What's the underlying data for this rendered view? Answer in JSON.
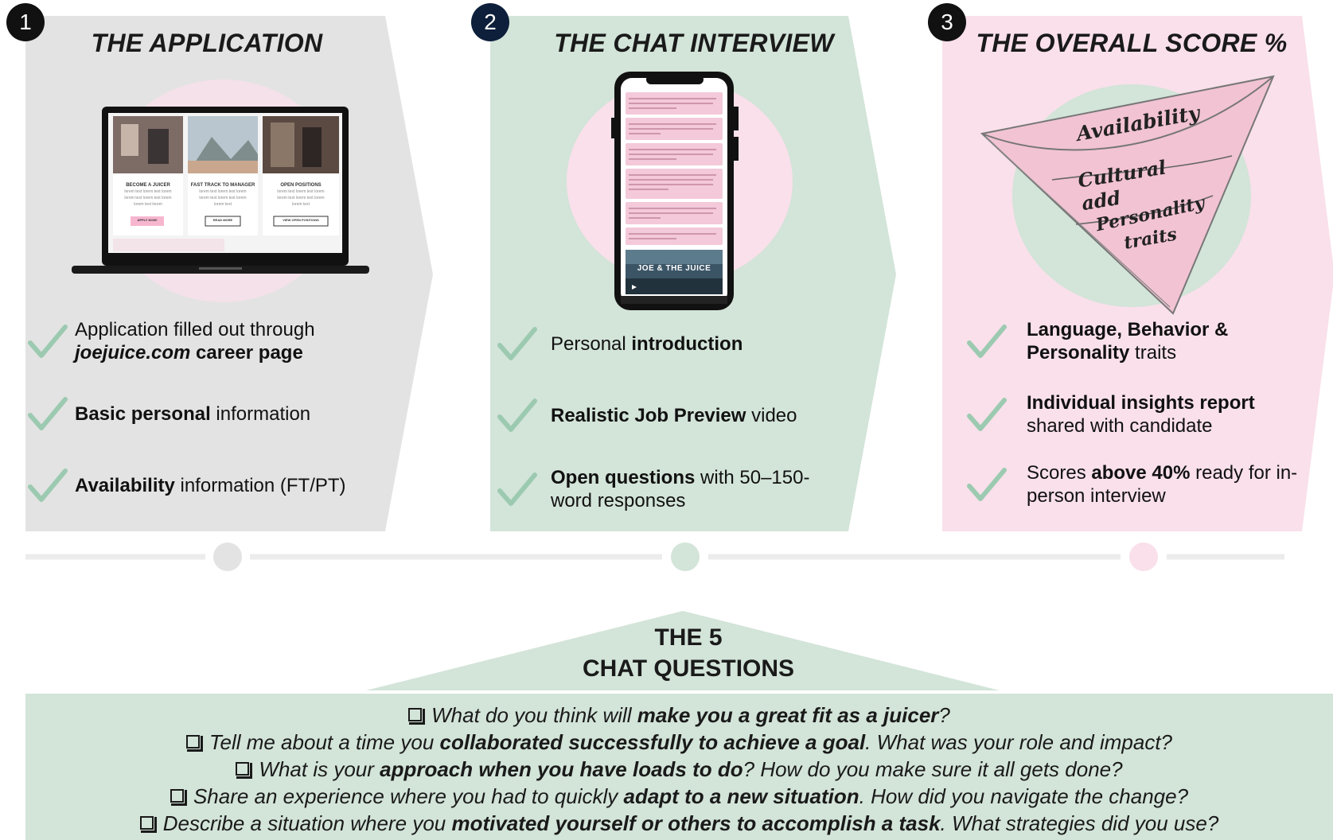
{
  "colors": {
    "stage1_bg": "#e3e3e3",
    "stage2_bg": "#d3e4d9",
    "stage3_bg": "#f9e0ea",
    "check": "#9ccab1",
    "step1_badge": "#111111",
    "step2_badge": "#0d1f3a",
    "step3_badge": "#111111",
    "timeline": "#ececec"
  },
  "stages": [
    {
      "number": "1",
      "title": "THE APPLICATION",
      "illustration": "laptop-career-page",
      "laptop_cards": [
        {
          "heading": "BECOME A JUICER",
          "button": "APPLY NOW!"
        },
        {
          "heading": "FAST TRACK TO MANAGER",
          "button": "READ MORE"
        },
        {
          "heading": "OPEN POSITIONS",
          "button": "VIEW OPEN POSITIONS"
        }
      ],
      "items": [
        {
          "lead": "Application filled out through",
          "strong_italic": "joejuice.com",
          "strong": " career page"
        },
        {
          "strong": "Basic personal",
          "rest": " information"
        },
        {
          "strong": "Availability",
          "rest": " information (FT/PT)"
        }
      ]
    },
    {
      "number": "2",
      "title": "THE CHAT INTERVIEW",
      "illustration": "phone-chat",
      "phone_video_title": "JOE & THE JUICE",
      "items": [
        {
          "lead": "Personal ",
          "strong": "introduction"
        },
        {
          "strong": "Realistic Job Preview",
          "rest": " video"
        },
        {
          "strong": "Open questions",
          "rest": " with 50–150-",
          "rest2": "word responses"
        }
      ]
    },
    {
      "number": "3",
      "title": "THE OVERALL SCORE %",
      "illustration": "funnel",
      "funnel_labels": [
        "Availability",
        "Cultural add",
        "Personality",
        "traits"
      ],
      "items": [
        {
          "strong": "Language, Behavior &",
          "strong2": "Personality",
          "rest": " traits"
        },
        {
          "strong": "Individual insights report",
          "line2": "shared with candidate"
        },
        {
          "lead": "Scores ",
          "strong": "above 40%",
          "rest": " ready for in-",
          "line2": "person interview"
        }
      ]
    }
  ],
  "questions": {
    "title_line1": "THE 5",
    "title_line2": "CHAT QUESTIONS",
    "list": [
      {
        "pre": "What do you think will ",
        "bold": "make you a great fit as a juicer",
        "post": "?"
      },
      {
        "pre": "Tell me about a time you ",
        "bold": "collaborated successfully to achieve a goal",
        "post": ". What was your role and impact?"
      },
      {
        "pre": "What is your ",
        "bold": "approach when you have loads to do",
        "post": "? How do you make sure it all gets done?"
      },
      {
        "pre": "Share an experience where you had to quickly ",
        "bold": "adapt to a new situation",
        "post": ". How did you navigate the change?"
      },
      {
        "pre": "Describe a situation where you ",
        "bold": "motivated yourself or others to accomplish a task",
        "post": ". What strategies did you use?"
      }
    ]
  }
}
